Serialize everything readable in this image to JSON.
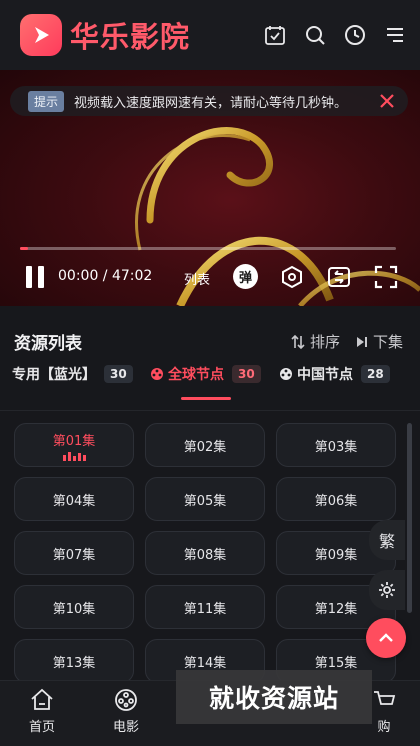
{
  "app": {
    "title": "华乐影院"
  },
  "header": {
    "icons": [
      "calendar-check-icon",
      "search-icon",
      "history-icon",
      "menu-icon"
    ]
  },
  "player": {
    "tip_badge": "提示",
    "tip_text": "视频载入速度跟网速有关，请耐心等待几秒钟。",
    "time": "00:00 / 47:02",
    "list_label": "列表",
    "danmu_label": "弹",
    "progress": 0.02
  },
  "resources": {
    "title": "资源列表",
    "sort_label": "排序",
    "next_label": "下集",
    "sources": [
      {
        "label": "专用【蓝光】",
        "count": "30",
        "active": false
      },
      {
        "label": "全球节点",
        "count": "30",
        "active": true
      },
      {
        "label": "中国节点",
        "count": "28",
        "active": false
      }
    ],
    "episodes": [
      "第01集",
      "第02集",
      "第03集",
      "第04集",
      "第05集",
      "第06集",
      "第07集",
      "第08集",
      "第09集",
      "第10集",
      "第11集",
      "第12集",
      "第13集",
      "第14集",
      "第15集"
    ],
    "active_episode": 0
  },
  "fabs": {
    "traditional": "繁"
  },
  "bottom_nav": {
    "items": [
      {
        "label": "首页",
        "icon": "home-icon"
      },
      {
        "label": "电影",
        "icon": "film-reel-icon"
      },
      {
        "label": "购",
        "icon": "cart-icon"
      }
    ]
  },
  "watermark": "就收资源站",
  "colors": {
    "accent": "#ff4d5e",
    "background": "#17181c"
  }
}
